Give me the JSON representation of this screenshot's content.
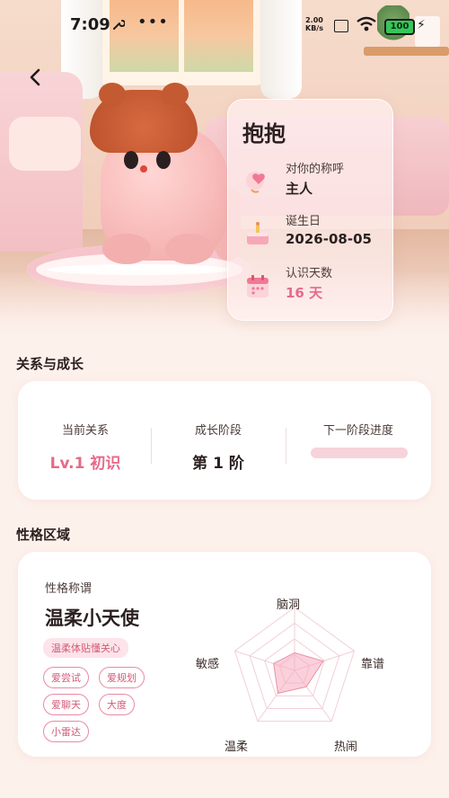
{
  "status": {
    "time": "7:09",
    "dots": "•••",
    "speed_value": "2.00",
    "speed_unit": "KB/s",
    "battery": "100"
  },
  "info": {
    "name": "抱抱",
    "rows": [
      {
        "label": "对你的称呼",
        "value": "主人",
        "icon": "heart-balloon-icon"
      },
      {
        "label": "诞生日",
        "value": "2026-08-05",
        "icon": "cake-icon"
      },
      {
        "label": "认识天数",
        "value": "16 天",
        "icon": "calendar-icon"
      }
    ]
  },
  "relation": {
    "section_title": "关系与成长",
    "current_label": "当前关系",
    "current_value": "Lv.1 初识",
    "stage_label": "成长阶段",
    "stage_value": "第 1 阶",
    "next_label": "下一阶段进度",
    "next_progress": 0.0
  },
  "personality": {
    "section_title": "性格区域",
    "label": "性格称谓",
    "name": "温柔小天使",
    "desc": "温柔体贴懂关心",
    "tags": [
      "爱尝试",
      "爱规划",
      "爱聊天",
      "大度",
      "小雷达"
    ],
    "radar": {
      "axes": [
        "脑洞",
        "靠谱",
        "热闹",
        "温柔",
        "敏感"
      ],
      "values": [
        0.28,
        0.48,
        0.32,
        0.45,
        0.35
      ]
    }
  },
  "colors": {
    "accent": "#e56a8a",
    "tag_border": "#e98aa4",
    "radar_fill": "#f5a9bd"
  }
}
